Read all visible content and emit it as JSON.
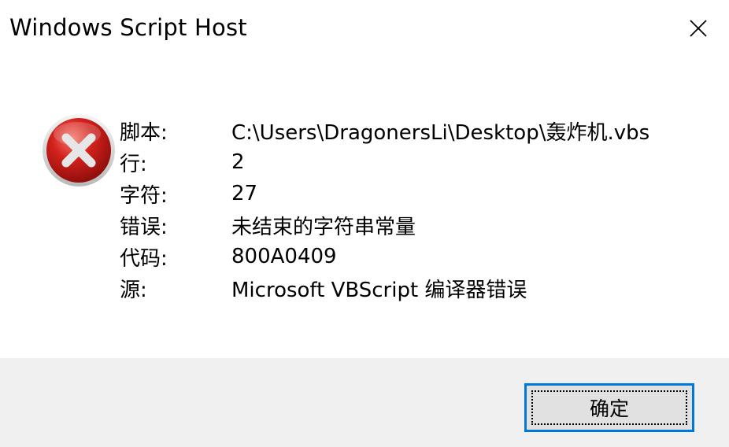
{
  "window": {
    "title": "Windows Script Host",
    "close_icon": "close-icon"
  },
  "message": {
    "icon": "error-icon",
    "rows": [
      {
        "label": "脚本:",
        "value": "C:\\Users\\DragonersLi\\Desktop\\轰炸机.vbs"
      },
      {
        "label": "行:",
        "value": "2"
      },
      {
        "label": "字符:",
        "value": "27"
      },
      {
        "label": "错误:",
        "value": "未结束的字符串常量"
      },
      {
        "label": "代码:",
        "value": "800A0409"
      },
      {
        "label": "源:",
        "value": "Microsoft VBScript 编译器错误"
      }
    ]
  },
  "footer": {
    "ok_label": "确定"
  },
  "colors": {
    "footer_bg": "#f0f0f0",
    "button_border": "#0078d7",
    "error_red": "#d3211c"
  }
}
